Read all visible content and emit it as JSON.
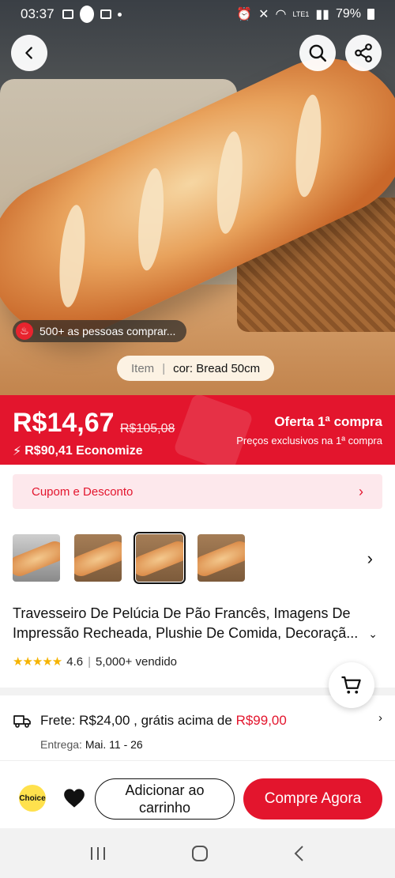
{
  "status_bar": {
    "time": "03:37",
    "battery": "79%",
    "network": "LTE1"
  },
  "hero": {
    "buyers_badge": "500+ as pessoas comprar...",
    "variant_key": "Item",
    "variant_value": "cor: Bread 50cm"
  },
  "price": {
    "current": "R$14,67",
    "original": "R$105,08",
    "savings": "R$90,41 Economize",
    "offer_title": "Oferta 1ª compra",
    "offer_subtitle": "Preços exclusivos na 1ª compra",
    "accent": "#e3152d"
  },
  "coupon": {
    "label": "Cupom e Desconto"
  },
  "product": {
    "title": "Travesseiro De Pelúcia De Pão Francês, Imagens De Impressão Recheada, Plushie De Comida, Decoraçã...",
    "rating": "4.6",
    "rating_stars": 4.6,
    "sold": "5,000+ vendido",
    "thumbnail_count": 4,
    "selected_thumbnail": 3
  },
  "shipping": {
    "label": "Frete: R$24,00 , grátis acima de ",
    "threshold": "R$99,00",
    "delivery_label": "Entrega:",
    "delivery_dates": "Mai. 11 - 26"
  },
  "actions": {
    "choice_badge": "Choice",
    "add_to_cart": "Adicionar ao carrinho",
    "buy_now": "Compre Agora"
  },
  "icons": [
    "back-icon",
    "search-icon",
    "share-icon",
    "fire-icon",
    "cart-icon",
    "truck-icon",
    "heart-icon",
    "chevron-right-icon",
    "chevron-down-icon"
  ]
}
